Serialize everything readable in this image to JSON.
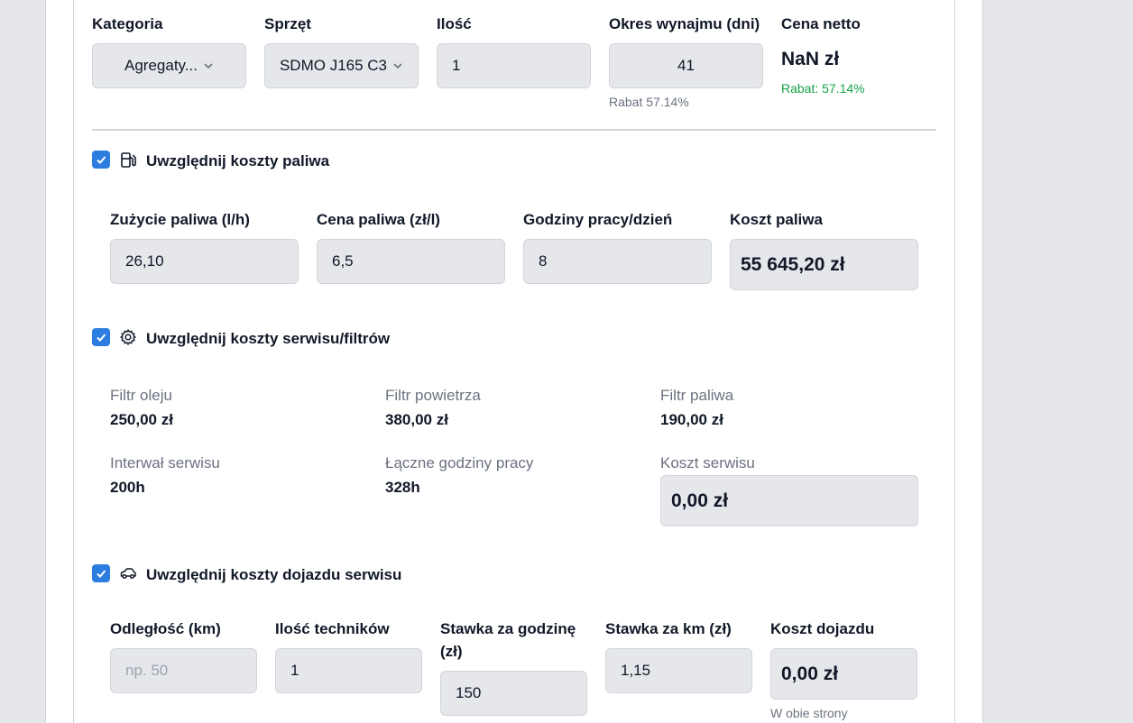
{
  "header": {
    "category_label": "Kategoria",
    "category_value": "Agregaty...",
    "equipment_label": "Sprzęt",
    "equipment_value": "SDMO J165 C3",
    "quantity_label": "Ilość",
    "quantity_value": "1",
    "period_label": "Okres wynajmu (dni)",
    "period_value": "41",
    "period_discount": "Rabat 57.14%",
    "net_price_label": "Cena netto",
    "net_price_value": "NaN zł",
    "net_price_discount": "Rabat: 57.14%"
  },
  "fuel": {
    "checked": true,
    "title": "Uwzględnij koszty paliwa",
    "icon": "fuel-pump-icon",
    "consumption_label": "Zużycie paliwa (l/h)",
    "consumption_value": "26,10",
    "price_label": "Cena paliwa (zł/l)",
    "price_value": "6,5",
    "hours_label": "Godziny pracy/dzień",
    "hours_value": "8",
    "cost_label": "Koszt paliwa",
    "cost_value": "55 645,20 zł"
  },
  "service": {
    "checked": true,
    "title": "Uwzględnij koszty serwisu/filtrów",
    "icon": "gear-icon",
    "oil_filter_label": "Filtr oleju",
    "oil_filter_value": "250,00 zł",
    "air_filter_label": "Filtr powietrza",
    "air_filter_value": "380,00 zł",
    "fuel_filter_label": "Filtr paliwa",
    "fuel_filter_value": "190,00 zł",
    "interval_label": "Interwał serwisu",
    "interval_value": "200h",
    "total_hours_label": "Łączne godziny pracy",
    "total_hours_value": "328h",
    "cost_label": "Koszt serwisu",
    "cost_value": "0,00 zł"
  },
  "travel": {
    "checked": true,
    "title": "Uwzględnij koszty dojazdu serwisu",
    "icon": "car-icon",
    "distance_label": "Odległość (km)",
    "distance_placeholder": "np. 50",
    "technicians_label": "Ilość techników",
    "technicians_value": "1",
    "hourly_label": "Stawka za godzinę (zł)",
    "hourly_value": "150",
    "km_rate_label": "Stawka za km (zł)",
    "km_rate_value": "1,15",
    "cost_label": "Koszt dojazdu",
    "cost_value": "0,00 zł",
    "cost_note": "W obie strony"
  },
  "colors": {
    "accent": "#2b7de0",
    "green": "#16a34a",
    "input_bg": "#e5e7eb"
  }
}
